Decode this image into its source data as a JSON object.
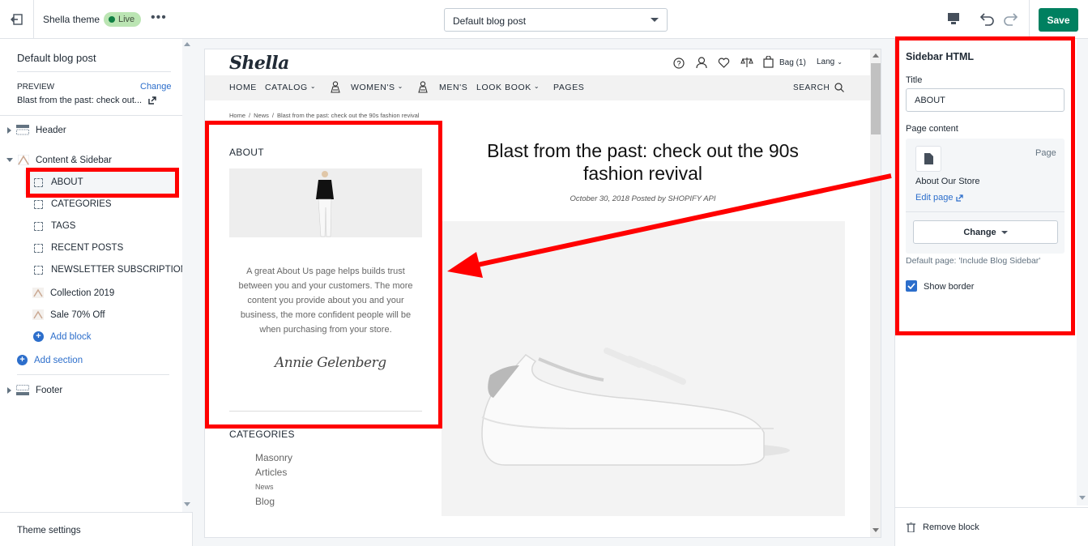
{
  "topbar": {
    "theme_name": "Shella theme",
    "live_badge": "Live",
    "more": "•••",
    "template_select": "Default blog post",
    "save_label": "Save"
  },
  "left_panel": {
    "title": "Default blog post",
    "preview_label": "PREVIEW",
    "change_link": "Change",
    "preview_value": "Blast from the past: check out...",
    "sections": {
      "header": "Header",
      "content_sidebar": "Content & Sidebar",
      "blocks": [
        "ABOUT",
        "CATEGORIES",
        "TAGS",
        "RECENT POSTS",
        "NEWSLETTER SUBSCRIPTION",
        "Collection 2019",
        "Sale 70% Off"
      ],
      "add_block": "Add block",
      "add_section": "Add section",
      "footer": "Footer"
    },
    "theme_settings": "Theme settings"
  },
  "store": {
    "logo": "Shella",
    "bag": "Bag (1)",
    "lang": "Lang",
    "nav": [
      "HOME",
      "CATALOG",
      "WOMEN'S",
      "MEN'S",
      "LOOK BOOK",
      "PAGES"
    ],
    "search": "SEARCH",
    "breadcrumb": [
      "Home",
      "News",
      "Blast from the past: check out the 90s fashion revival"
    ],
    "sidebar_about_title": "ABOUT",
    "about_text": "A great About Us page helps builds trust between you and your customers. The more content you provide about you and your business, the more confident people will be when purchasing from your store.",
    "signature": "Annie Gelenberg",
    "categories_title": "CATEGORIES",
    "categories": [
      "Masonry",
      "Articles",
      "News",
      "Blog"
    ],
    "post_title": "Blast from the past: check out the 90s fashion revival",
    "post_meta": "October 30, 2018 Posted by SHOPIFY API"
  },
  "right_panel": {
    "title": "Sidebar HTML",
    "title_label": "Title",
    "title_value": "ABOUT",
    "page_content_label": "Page content",
    "page_tag": "Page",
    "page_name": "About Our Store",
    "edit_page": "Edit page",
    "change_button": "Change",
    "default_page_hint": "Default page: 'Include Blog Sidebar'",
    "show_border_label": "Show border",
    "show_border_checked": true,
    "remove_block": "Remove block"
  },
  "colors": {
    "accent_red": "#ff0000",
    "save_green": "#008060",
    "link_blue": "#2c6ecb"
  }
}
